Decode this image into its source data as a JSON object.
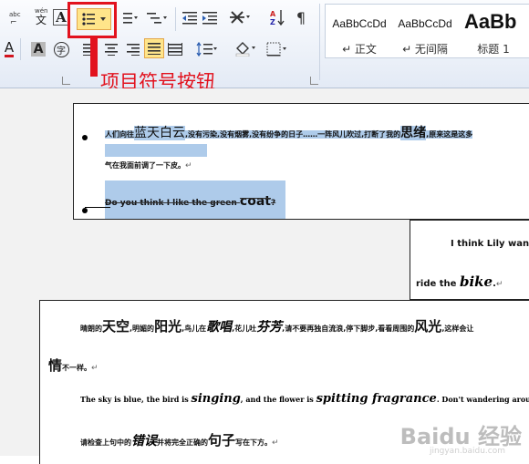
{
  "ribbon": {
    "font_btn_a": "A",
    "font_btn_a2": "A",
    "char_btn": "字",
    "wen_btn": "wén\n文",
    "abc_btn": "abc",
    "styles": [
      {
        "preview": "AaBbCcDd",
        "label": "↵ 正文"
      },
      {
        "preview": "AaBbCcDd",
        "label": "↵ 无间隔"
      },
      {
        "preview": "AaBb",
        "label": "标题 1"
      }
    ]
  },
  "annotation": {
    "label": "项目符号按钮"
  },
  "doc": {
    "box1": {
      "line1_a": "人们向往",
      "line1_b": "蓝天白云",
      "line1_c": ",没有污染,没有烟雾,没有纷争的日子……一阵风儿吹过,打断了我的",
      "line1_d": "思绪",
      "line1_e": ",原来这是这多",
      "line2": "气在我面前调了一下皮。",
      "line3_a": "Do you think I like the green ",
      "line3_b": "coat",
      "line3_c": "?"
    },
    "box2": {
      "line1": "I  think  Lily  wan",
      "line2_a": "ride the ",
      "line2_b": "bike",
      "line2_c": "."
    },
    "box3": {
      "p1_a": "晴朗的",
      "p1_b": "天空",
      "p1_c": ",明媚的",
      "p1_d": "阳光",
      "p1_e": ",鸟儿在",
      "p1_f": "歌唱",
      "p1_g": ",花儿吐",
      "p1_h": "芬芳",
      "p1_i": ",请不要再独自流浪,停下脚步,看看周围的",
      "p1_j": "风光",
      "p1_k": ",这样会让",
      "p2_a": "情",
      "p2_b": "不一样。",
      "p3_a": "The sky is blue, the bird is ",
      "p3_b": "singing",
      "p3_c": ", and the flower is ",
      "p3_d": "spitting fragrance",
      "p3_e": ". Don't wandering around alone.",
      "p4_a": "请检查上句中的",
      "p4_b": "错误",
      "p4_c": "并将完全正确的",
      "p4_d": "句子",
      "p4_e": "写在下方。"
    },
    "watermark": "Baidu 经验",
    "watermark_sub": "jingyan.baidu.com"
  }
}
